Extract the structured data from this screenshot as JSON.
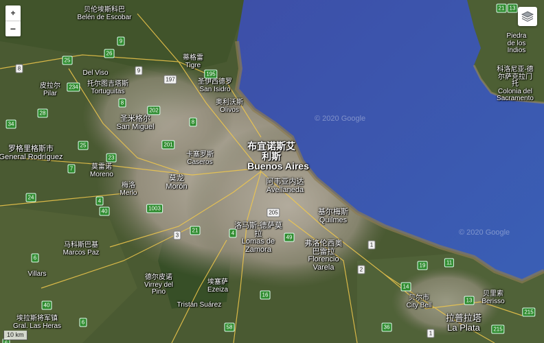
{
  "controls": {
    "zoom_in": "+",
    "zoom_out": "−",
    "layers_icon": "layers-icon"
  },
  "scale": "10 km",
  "watermarks": [
    "© 2020 Google",
    "© 2020 Google"
  ],
  "places": [
    {
      "zh": "贝伦埃斯科巴",
      "en": "Belén de Escobar"
    },
    {
      "zh": "蒂格雷",
      "en": "Tigre"
    },
    {
      "zh": "圣伊西德罗",
      "en": "San Isidro"
    },
    {
      "zh": "奥利沃斯",
      "en": "Olivos"
    },
    {
      "zh": "皮拉尔",
      "en": "Pilar"
    },
    {
      "zh": "",
      "en": "Del Viso"
    },
    {
      "zh": "托尔图吉塔斯",
      "en": "Tortuguitas"
    },
    {
      "zh": "圣米格尔",
      "en": "San Miguel"
    },
    {
      "zh": "罗格里格斯市",
      "en": "General Rodríguez"
    },
    {
      "zh": "莫雷诺",
      "en": "Moreno"
    },
    {
      "zh": "卡塞罗斯",
      "en": "Caseros"
    },
    {
      "zh": "布宜诺斯艾利斯",
      "en": "Buenos Aires"
    },
    {
      "zh": "梅洛",
      "en": "Merlo"
    },
    {
      "zh": "莫龙",
      "en": "Morón"
    },
    {
      "zh": "阿韦亚内达",
      "en": "Avellaneda"
    },
    {
      "zh": "基尔梅斯",
      "en": "Quilmes"
    },
    {
      "zh": "洛马斯-德萨莫拉",
      "en": "Lomas de Zamora"
    },
    {
      "zh": "弗洛伦西奥巴雷拉",
      "en": "Florencio Varela"
    },
    {
      "zh": "马科斯巴基",
      "en": "Marcos Paz"
    },
    {
      "zh": "",
      "en": "Villars"
    },
    {
      "zh": "德尔皮诺",
      "en": "Virrey del Pino"
    },
    {
      "zh": "埃塞萨",
      "en": "Ezeiza"
    },
    {
      "zh": "",
      "en": "Tristán Suárez"
    },
    {
      "zh": "贝尔市",
      "en": "City Bell"
    },
    {
      "zh": "贝里索",
      "en": "Berisso"
    },
    {
      "zh": "拉普拉塔",
      "en": "La Plata"
    },
    {
      "zh": "埃拉斯将军镇",
      "en": "Gral. Las Heras"
    },
    {
      "zh": "",
      "en": "Piedra de los Indios"
    },
    {
      "zh": "科洛尼亚-德尔萨克拉门托",
      "en": "Colonia del Sacramento"
    }
  ],
  "routes": [
    "9",
    "26",
    "9",
    "8",
    "25",
    "197",
    "195",
    "234",
    "8",
    "202",
    "28",
    "34",
    "8",
    "201",
    "25",
    "23",
    "7",
    "24",
    "4",
    "1003",
    "40",
    "21",
    "3",
    "205",
    "1",
    "4",
    "49",
    "2",
    "19",
    "11",
    "14",
    "13",
    "6",
    "6",
    "40",
    "6",
    "16",
    "58",
    "36",
    "215",
    "215",
    "21",
    "13",
    "1"
  ]
}
